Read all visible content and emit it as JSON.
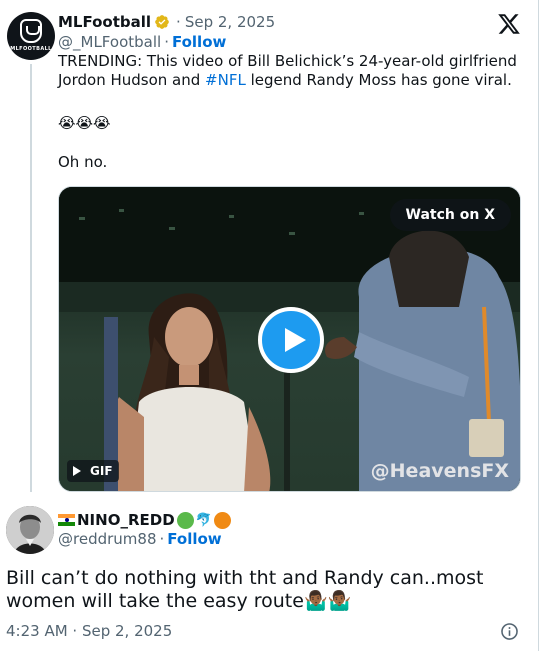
{
  "quoted": {
    "avatar_text": "MLFOOTBALL",
    "name": "MLFootball",
    "dot": "·",
    "date": "Sep 2, 2025",
    "handle": "@_MLFootball",
    "separator": "·",
    "follow": "Follow",
    "text_before": "TRENDING: This video of Bill Belichick’s 24-year-old girlfriend Jordon Hudson and ",
    "hashtag": "#NFL",
    "text_after": " legend Randy Moss has gone viral.",
    "emojis": "😭😭😭",
    "line2": "Oh no.",
    "media": {
      "watch_label": "Watch on X",
      "gif_label": "GIF",
      "watermark": "@HeavensFX"
    }
  },
  "main": {
    "name": "NINO_REDD",
    "name_emoji_mid": "🐬",
    "handle": "@reddrum88",
    "separator": "·",
    "follow": "Follow",
    "text": "Bill can’t do nothing with tht and Randy can..most women will take the easy route🤷🏾‍♂️🤷🏾‍♂️",
    "time": "4:23 AM · Sep 2, 2025"
  },
  "colors": {
    "link": "#006fd6",
    "play": "#1d9bf0",
    "green_circle": "#5ab94a",
    "orange_circle": "#f08a14"
  },
  "icons": [
    "x-logo-icon",
    "verified-badge-icon",
    "play-icon",
    "gif-play-icon",
    "info-icon",
    "india-flag-icon"
  ]
}
